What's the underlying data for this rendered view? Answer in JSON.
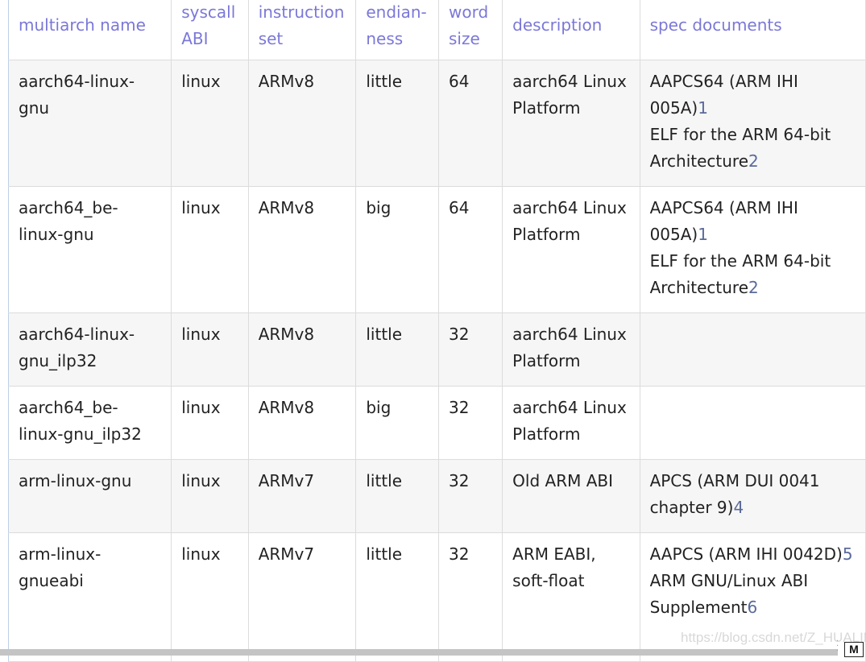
{
  "table": {
    "headers": [
      {
        "line1": "multiarch name",
        "line2": ""
      },
      {
        "line1": "syscall",
        "line2": "ABI"
      },
      {
        "line1": "instruction",
        "line2": "set"
      },
      {
        "line1": "endian-",
        "line2": "ness"
      },
      {
        "line1": "word",
        "line2": "size"
      },
      {
        "line1": "description",
        "line2": ""
      },
      {
        "line1": "spec documents",
        "line2": ""
      }
    ],
    "rows": [
      {
        "name": "aarch64-linux-gnu",
        "abi": "linux",
        "isa": "ARMv8",
        "endian": "little",
        "word": "64",
        "description": "aarch64 Linux Platform",
        "docs": [
          {
            "text": "AAPCS64 (ARM IHI 005A)",
            "ref": "1"
          },
          {
            "text": "ELF for the ARM 64-bit Architecture",
            "ref": "2"
          }
        ]
      },
      {
        "name": "aarch64_be-linux-gnu",
        "abi": "linux",
        "isa": "ARMv8",
        "endian": "big",
        "word": "64",
        "description": "aarch64 Linux Platform",
        "docs": [
          {
            "text": "AAPCS64 (ARM IHI 005A)",
            "ref": "1"
          },
          {
            "text": "ELF for the ARM 64-bit Architecture",
            "ref": "2"
          }
        ]
      },
      {
        "name": "aarch64-linux-gnu_ilp32",
        "abi": "linux",
        "isa": "ARMv8",
        "endian": "little",
        "word": "32",
        "description": "aarch64 Linux Platform",
        "docs": []
      },
      {
        "name": "aarch64_be-linux-gnu_ilp32",
        "abi": "linux",
        "isa": "ARMv8",
        "endian": "big",
        "word": "32",
        "description": "aarch64 Linux Platform",
        "docs": []
      },
      {
        "name": "arm-linux-gnu",
        "abi": "linux",
        "isa": "ARMv7",
        "endian": "little",
        "word": "32",
        "description": "Old ARM ABI",
        "docs": [
          {
            "text": "APCS (ARM DUI 0041 chapter 9)",
            "ref": "4"
          }
        ]
      },
      {
        "name": "arm-linux-gnueabi",
        "abi": "linux",
        "isa": "ARMv7",
        "endian": "little",
        "word": "32",
        "description": "ARM EABI, soft-float",
        "docs": [
          {
            "text": "AAPCS (ARM IHI 0042D)",
            "ref": "5"
          },
          {
            "text": "ARM GNU/Linux ABI Supplement",
            "ref": "6"
          }
        ]
      }
    ]
  },
  "watermark": "https://blog.csdn.net/Z_HUALIN",
  "corner_badge": "M",
  "colors": {
    "header_text": "#7b78d8",
    "ref_link": "#5a6a9a",
    "stripe": "#f6f6f6"
  }
}
